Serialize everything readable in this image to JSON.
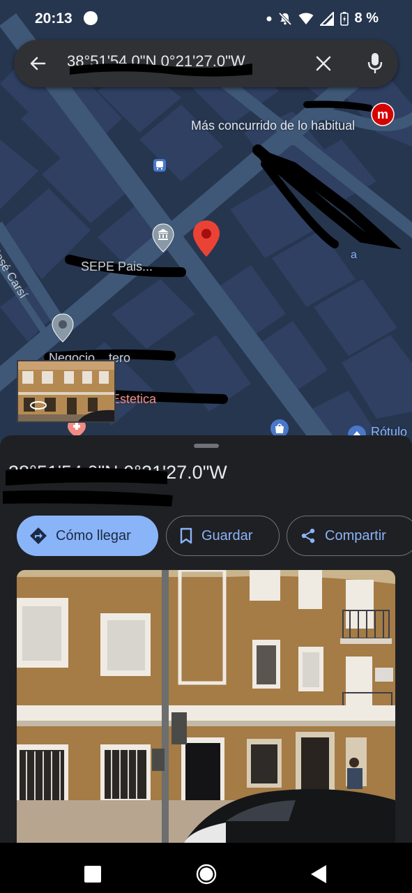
{
  "status_bar": {
    "time": "20:13",
    "battery": "8 %",
    "icons": [
      "notification-dot-icon",
      "small-dot-icon",
      "bell-off-icon",
      "wifi-icon",
      "signal-icon",
      "battery-icon"
    ]
  },
  "search": {
    "query": "38°51'54.0\"N 0°21'27.0\"W",
    "icons": [
      "arrow-back-icon",
      "close-icon",
      "mic-icon"
    ]
  },
  "map": {
    "labels": {
      "busy_place": "Más concurrido de lo habitual",
      "street_jose_carsi": "José Carsí",
      "sepe_label": "SEPE Pais...",
      "partial_label_a": "a",
      "bottom_label": "Rótulo",
      "estetica": "Estetica",
      "negocio": "Negocio ...tero"
    },
    "icons": [
      "metro-icon",
      "bus-stop-icon",
      "museum-pin-icon",
      "location-pin-icon",
      "place-pin-icon",
      "pharmacy-pin-icon",
      "shopping-pin-icon",
      "street-view-icon"
    ],
    "colors": {
      "base": "#26364f",
      "blocks": "#2f4063",
      "roads": "#3f5877",
      "pin": "#ea4335"
    }
  },
  "place": {
    "coords": "38°51'54.0\"N 0°21'27.0\"W",
    "actions": {
      "directions": "Cómo llegar",
      "save": "Guardar",
      "share": "Compartir"
    }
  },
  "accent": "#8ab4f8"
}
